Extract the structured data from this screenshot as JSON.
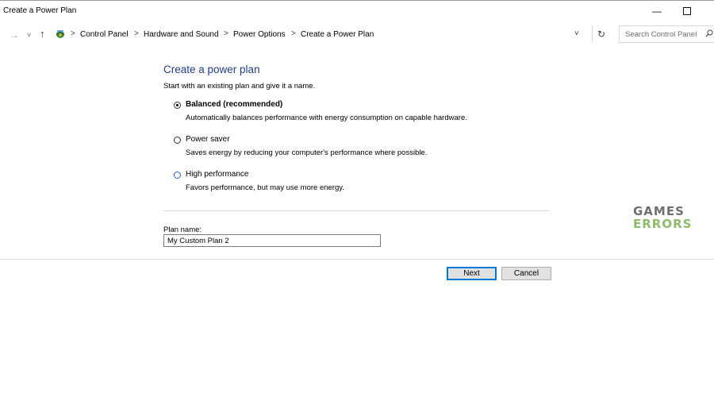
{
  "window": {
    "title": "Create a Power Plan",
    "controls": {
      "minimize": "—"
    }
  },
  "nav": {
    "back_glyph": "→",
    "recent_glyph": "˅",
    "up_glyph": "↑"
  },
  "address": {
    "crumbs": [
      "Control Panel",
      "Hardware and Sound",
      "Power Options",
      "Create a Power Plan"
    ],
    "separator": ">",
    "dropdown_glyph": "˅",
    "refresh_glyph": "↻"
  },
  "search": {
    "placeholder": "Search Control Panel"
  },
  "main": {
    "heading": "Create a power plan",
    "subheading": "Start with an existing plan and give it a name.",
    "options": [
      {
        "label": "Balanced (recommended)",
        "description": "Automatically balances performance with energy consumption on capable hardware.",
        "selected": true
      },
      {
        "label": "Power saver",
        "description": "Saves energy by reducing your computer's performance where possible.",
        "selected": false
      },
      {
        "label": "High performance",
        "description": "Favors performance, but may use more energy.",
        "selected": false
      }
    ],
    "plan_name_label": "Plan name:",
    "plan_name_value": "My Custom Plan 2"
  },
  "buttons": {
    "next": "Next",
    "cancel": "Cancel"
  },
  "watermark": {
    "line1": "GAMES",
    "line2": "ERRORS"
  },
  "colors": {
    "heading": "#1e3d8f",
    "accent": "#0078d7",
    "watermark_green": "#8dbb6c"
  },
  "icons": {
    "control_panel": "control-panel-icon",
    "search": "search-icon",
    "refresh": "refresh-icon"
  }
}
